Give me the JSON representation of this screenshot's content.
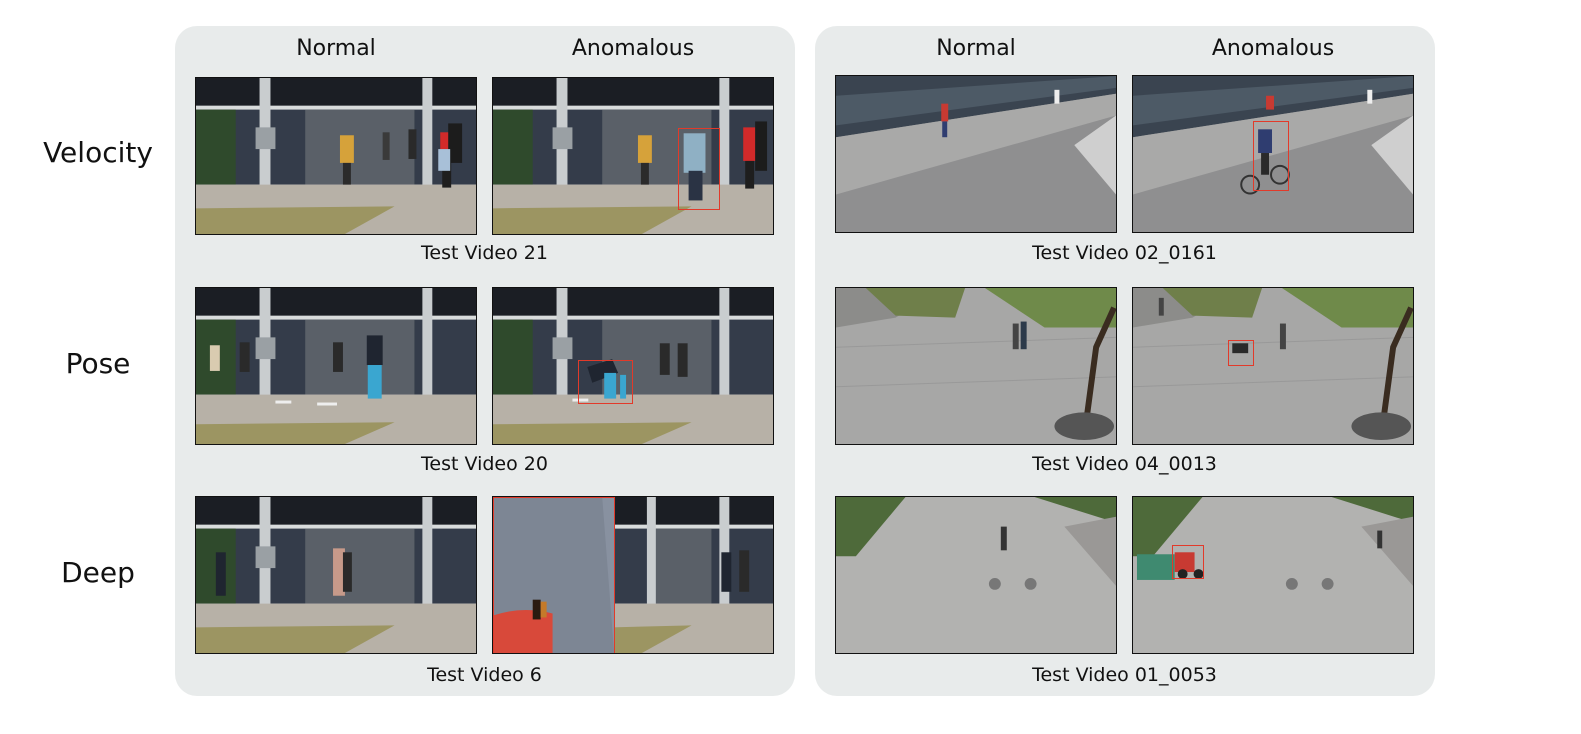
{
  "rows": [
    {
      "label": "Velocity"
    },
    {
      "label": "Pose"
    },
    {
      "label": "Deep"
    }
  ],
  "panels": [
    {
      "col_normal": "Normal",
      "col_anomalous": "Anomalous",
      "captions": [
        "Test Video 21",
        "Test Video 20",
        "Test Video 6"
      ]
    },
    {
      "col_normal": "Normal",
      "col_anomalous": "Anomalous",
      "captions": [
        "Test Video 02_0161",
        "Test Video 04_0013",
        "Test Video 01_0053"
      ]
    }
  ],
  "colors": {
    "panel_bg": "#e8ebeb",
    "bbox": "#e23a2a",
    "frame_border": "#111111"
  }
}
